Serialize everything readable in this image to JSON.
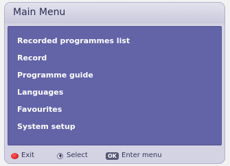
{
  "menu": {
    "title": "Main Menu",
    "items": [
      {
        "label": "Recorded programmes list"
      },
      {
        "label": "Record"
      },
      {
        "label": "Programme guide"
      },
      {
        "label": "Languages"
      },
      {
        "label": "Favourites"
      },
      {
        "label": "System setup"
      }
    ]
  },
  "footer": {
    "exit_label": "Exit",
    "select_label": "Select",
    "ok_badge": "OK",
    "enter_label": "Enter menu"
  },
  "colors": {
    "panel_bg": "#6363a8",
    "frame_bg": "#d3d3e3",
    "exit_button": "#d40000"
  },
  "icons": {
    "exit": "red-button-icon",
    "select": "up-down-arrows-icon",
    "ok": "ok-button-icon"
  }
}
